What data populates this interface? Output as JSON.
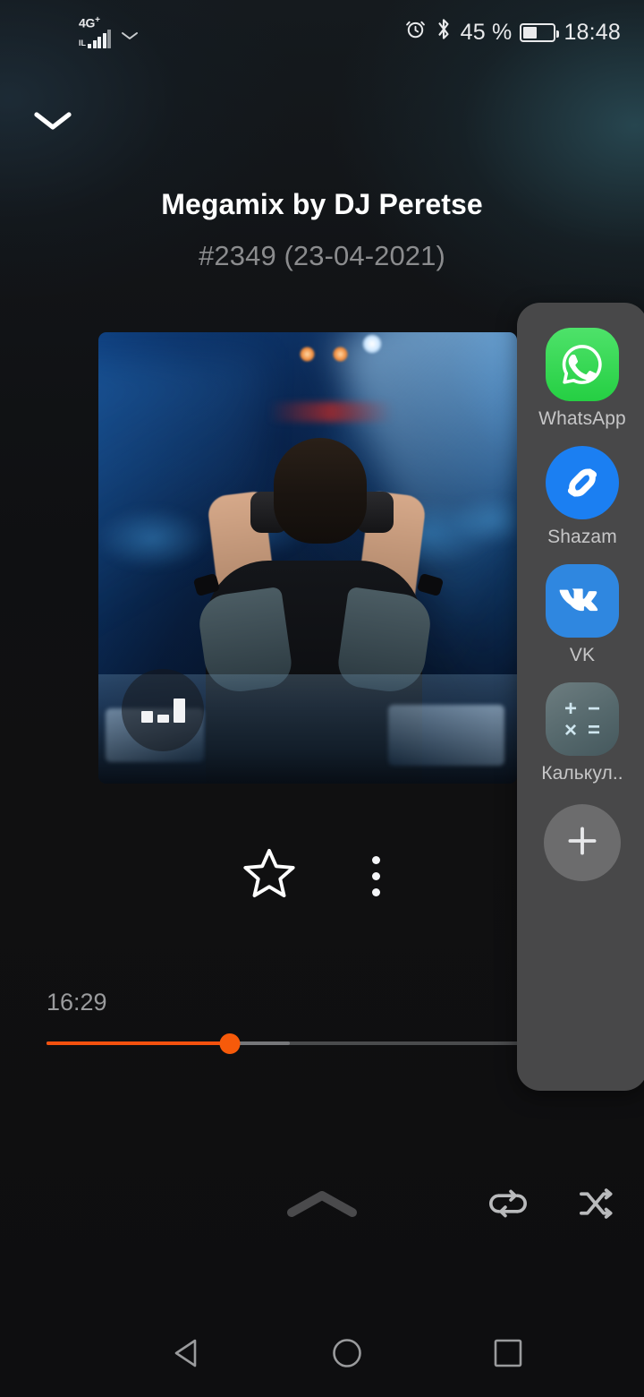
{
  "status_bar": {
    "network_label": "4G",
    "network_sup": "+",
    "network_sub": "IL",
    "signal_icon": "signal-bars-icon",
    "dropdown_icon": "chevron-down-icon",
    "alarm_icon": "alarm-clock-icon",
    "bluetooth_icon": "bluetooth-icon",
    "battery_percent": "45 %",
    "battery_icon": "battery-icon",
    "clock": "18:48"
  },
  "player": {
    "collapse_icon": "chevron-down-icon",
    "title": "Megamix by DJ Peretse",
    "subtitle": "#2349 (23-04-2021)",
    "cover_alt": "DJ wearing headphones in front of a crowd with blue stage lights",
    "equalizer_badge": "equalizer-icon",
    "favorite_icon": "star-outline-icon",
    "more_icon": "more-vertical-icon",
    "elapsed": "16:29",
    "progress_percent": 32.5,
    "buffer_percent": 43,
    "accent_color": "#f4510e",
    "track_color": "#4a4b4d",
    "buffer_color": "#76777a",
    "expand_icon": "chevron-up-icon",
    "repeat_icon": "repeat-icon",
    "shuffle_icon": "shuffle-icon"
  },
  "share_panel": {
    "background_color": "#484849",
    "items": [
      {
        "label": "WhatsApp",
        "icon": "whatsapp-icon",
        "color": "#25cf43"
      },
      {
        "label": "Shazam",
        "icon": "shazam-icon",
        "color": "#1b7ff2"
      },
      {
        "label": "VK",
        "icon": "vk-icon",
        "color": "#2f87e0"
      },
      {
        "label": "Калькул..",
        "icon": "calculator-icon",
        "color": "#55686c"
      }
    ],
    "calculator_symbols": [
      "+",
      "−",
      "×",
      "="
    ],
    "add_button": {
      "label": "+",
      "icon": "plus-icon"
    }
  },
  "nav_bar": {
    "back_icon": "triangle-back-icon",
    "home_icon": "circle-home-icon",
    "recents_icon": "square-recents-icon"
  }
}
